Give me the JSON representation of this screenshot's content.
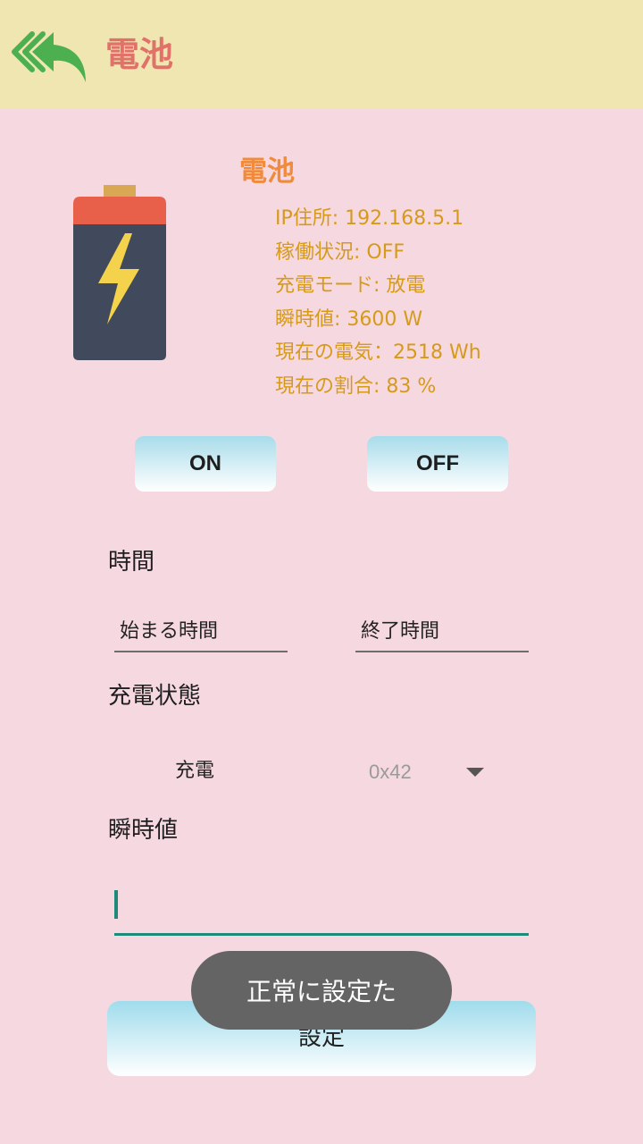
{
  "header": {
    "title": "電池",
    "back_icon": "back-arrow-icon",
    "accent_color": "#e0726a",
    "bar_color": "#f0e6b2"
  },
  "device": {
    "icon": "battery-icon",
    "name": "電池",
    "info": [
      "IP住所: 192.168.5.1",
      "稼働状況: OFF",
      "充電モード: 放電",
      "瞬時値: 3600 W",
      "現在の電気：2518 Wh",
      "現在の割合: 83 %"
    ]
  },
  "controls": {
    "on_label": "ON",
    "off_label": "OFF"
  },
  "time_section": {
    "label": "時間",
    "start_placeholder": "始まる時間",
    "end_placeholder": "終了時間"
  },
  "charge_section": {
    "label": "充電状態",
    "mode_label": "充電",
    "selected_value": "0x42"
  },
  "instant_section": {
    "label": "瞬時値",
    "value": ""
  },
  "set_button": {
    "label": "設定"
  },
  "toast": {
    "message": "正常に設定た"
  }
}
